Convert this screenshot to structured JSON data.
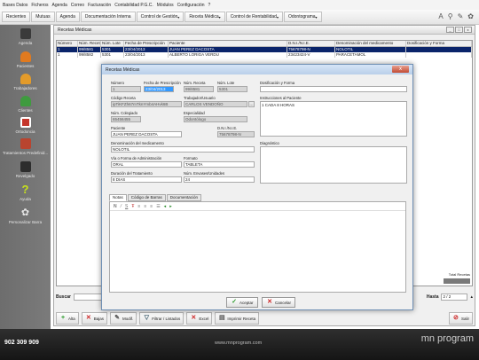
{
  "menu": [
    "Bases Datos",
    "Ficheros",
    "Agenda",
    "Correo",
    "Facturación",
    "Contabilidad P.G.C.",
    "Módulos",
    "Configuración",
    "?"
  ],
  "tabs": [
    "Recientes",
    "Mutuas",
    "Agenda",
    "Documentación Interna",
    "Control de Gestión",
    "Receta Médica",
    "Control de Rentabilidad",
    "Odontograma"
  ],
  "top_icons": [
    "font-size-icon",
    "search-icon",
    "settings-icon",
    "gear-icon"
  ],
  "sidebar": [
    "Agenda",
    "Pacientes",
    "Trabajadores",
    "Clientes",
    "Ortodoncia",
    "Tratamientos Predefinid...",
    "Revelgado",
    "Ayuda",
    "Personalizar Barra"
  ],
  "inner_title": "Recetas Médicas",
  "grid": {
    "headers": [
      "Número",
      "Núm. Receta",
      "Núm. Lote",
      "Fecha de Prescripción",
      "Paciente",
      "D.N.I./N.I.E.",
      "Denominación del medicamento",
      "Dosificación y Forma"
    ],
    "rows": [
      [
        "1",
        "99/8581",
        "5301",
        "23/04/2013",
        "JUAN PEREZ DACOSTA",
        "75678798-N",
        "NOLOTIL",
        ""
      ],
      [
        "1",
        "99/8582",
        "5301",
        "23/04/2013",
        "ALBERTO LORIGA VERDU",
        "23423424-V",
        "PARACETAMOL",
        ""
      ]
    ]
  },
  "total_label": "Total Recetas",
  "search_label": "Buscar",
  "hasta_label": "Hasta",
  "hasta_value": "2 / 2",
  "actions": [
    "Alta",
    "Bajas",
    "Modif.",
    "Filtrar / Listados",
    "Excel",
    "Imprimir Receta"
  ],
  "exit_label": "Salir",
  "footer": {
    "phone": "902 309 909",
    "url": "www.mnprogram.com",
    "brand": "mn program"
  },
  "dialog": {
    "title": "Recetas Médicas",
    "numero_label": "Número",
    "numero": "1",
    "fecha_label": "Fecha de Prescripción",
    "fecha": "23/04/2013",
    "num_receta_label": "Núm. Receta",
    "num_receta": "99/8581",
    "num_lote_label": "Núm. Lote",
    "num_lote": "5301",
    "codigo_label": "Código Receta",
    "codigo": "ipTiKFZh67mTknYmb4AHvk6B",
    "trabajador_label": "Trabajador/Usuario",
    "trabajador": "CARLOS VENDOÑO",
    "colegiado_label": "Núm. Colegiado",
    "colegiado": "65456455",
    "especialidad_label": "Especialidad",
    "especialidad": "Odontólogo",
    "paciente_label": "Paciente",
    "paciente": "JUAN PEREZ DACOSTA",
    "dni_label": "D.N.I./N.I.E.",
    "dni": "75678798-N",
    "denominacion_label": "Denominación del medicamento",
    "denominacion": "NOLOTIL",
    "via_label": "Vía o Forma de Administración",
    "via": "ORAL",
    "formato_label": "Formato",
    "formato": "TABLETA",
    "duracion_label": "Duración del Tratamiento",
    "duracion": "8 DIAS",
    "envases_label": "Núm. Envases/Unidades",
    "envases": "24",
    "dosificacion_label": "Dosificación y Forma",
    "instrucciones_label": "Instrucciones al Paciente",
    "instrucciones": "1 CADA 8 HORAS",
    "diagnostico_label": "Diagnóstico",
    "tabs": [
      "Notas",
      "Código de Barras",
      "Documentación"
    ],
    "accept": "Aceptar",
    "cancel": "Cancelar"
  },
  "colors": {
    "selection": "#0a246a",
    "sidebar": "#747474",
    "footer": "#1e1e1e",
    "field_highlight": "#3399ff"
  }
}
